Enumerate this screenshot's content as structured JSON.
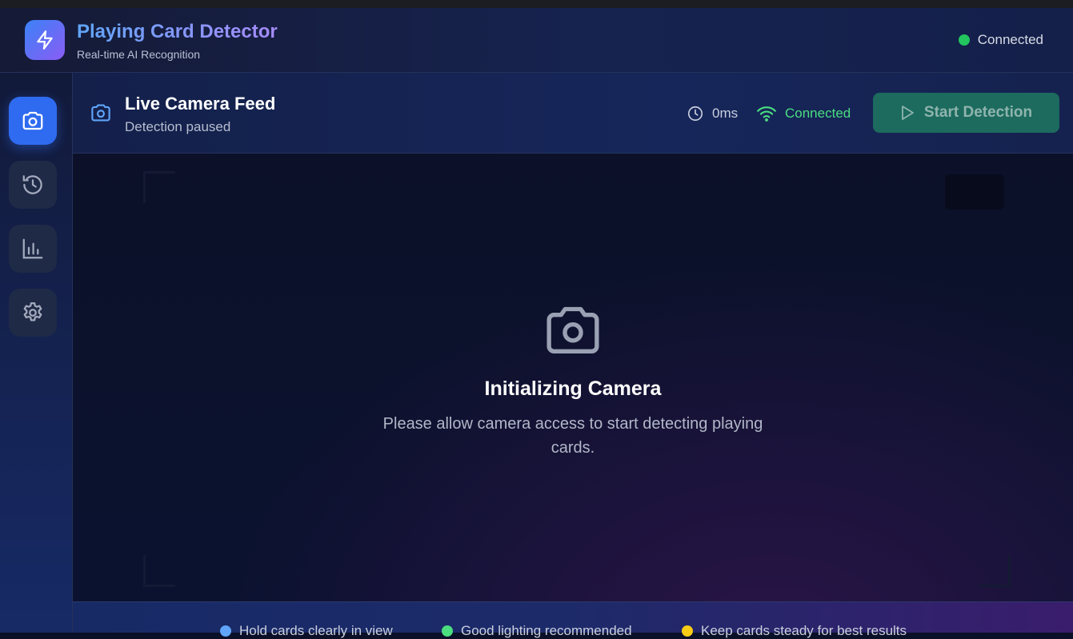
{
  "header": {
    "title": "Playing Card Detector",
    "subtitle": "Real-time AI Recognition",
    "status": "Connected",
    "status_color": "#22c55e"
  },
  "sidebar": {
    "items": [
      {
        "icon": "camera-icon",
        "active": true
      },
      {
        "icon": "history-icon",
        "active": false
      },
      {
        "icon": "bar-chart-icon",
        "active": false
      },
      {
        "icon": "gear-icon",
        "active": false
      }
    ]
  },
  "panel": {
    "title": "Live Camera Feed",
    "subtitle": "Detection paused",
    "latency": "0ms",
    "connection": "Connected",
    "start_label": "Start Detection"
  },
  "camera": {
    "title": "Initializing Camera",
    "message": "Please allow camera access to start detecting playing cards."
  },
  "tips": [
    {
      "text": "Hold cards clearly in view",
      "color": "#60a5fa"
    },
    {
      "text": "Good lighting recommended",
      "color": "#4ade80"
    },
    {
      "text": "Keep cards steady for best results",
      "color": "#facc15"
    }
  ]
}
